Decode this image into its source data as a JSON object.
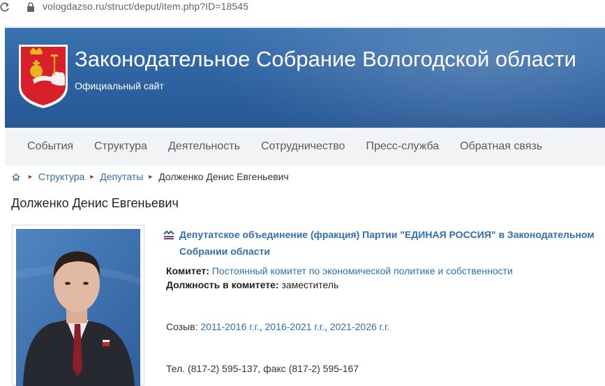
{
  "browser": {
    "url": "vologdazso.ru/struct/deput/item.php?ID=18545"
  },
  "header": {
    "title": "Законодательное Собрание Вологодской области",
    "subtitle": "Официальный сайт"
  },
  "nav": {
    "items": [
      {
        "label": "События"
      },
      {
        "label": "Структура"
      },
      {
        "label": "Деятельность"
      },
      {
        "label": "Сотрудничество"
      },
      {
        "label": "Пресс-служба"
      },
      {
        "label": "Обратная связь"
      }
    ]
  },
  "breadcrumb": {
    "items": [
      {
        "label": "Структура"
      },
      {
        "label": "Депутаты"
      },
      {
        "label": "Долженко Денис Евгеньевич"
      }
    ]
  },
  "deputy": {
    "name": "Долженко Денис Евгеньевич",
    "fraction": "Депутатское объединение (фракция) Партии \"ЕДИНАЯ РОССИЯ\" в Законодательном Собрании области",
    "committee_label": "Комитет:",
    "committee": "Постоянный комитет по экономической политике и собственности",
    "position_label": "Должность в комитете:",
    "position": "заместитель",
    "convocation_label": "Созыв:",
    "convocations": [
      "2011-2016 г.г.",
      "2016-2021 г.г.",
      "2021-2026 г.г."
    ],
    "convocation_sep": ", ",
    "phone": "Тел. (817-2) 595-137, факс (817-2) 595-167"
  },
  "icons": {
    "reload": "reload-icon",
    "lock": "lock-icon",
    "home": "home-icon",
    "party": "party-logo-icon",
    "coat": "coat-of-arms"
  },
  "colors": {
    "header_blue": "#2d61a0",
    "link_blue": "#2f6fb0",
    "nav_bg": "#f2f3f4"
  }
}
